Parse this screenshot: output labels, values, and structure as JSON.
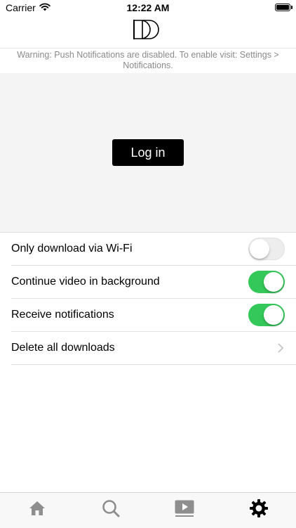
{
  "status_bar": {
    "carrier": "Carrier",
    "time": "12:22 AM",
    "wifi_icon": "wifi-icon",
    "battery_icon": "battery-icon"
  },
  "nav_bar": {
    "logo_icon": "dd-logo-icon"
  },
  "warning": {
    "text": "Warning: Push Notifications are disabled. To enable visit: Settings > Notifications."
  },
  "login": {
    "button_label": "Log in"
  },
  "settings": {
    "items": [
      {
        "label": "Only download via Wi-Fi",
        "control": "toggle",
        "on": false
      },
      {
        "label": "Continue video in background",
        "control": "toggle",
        "on": true
      },
      {
        "label": "Receive notifications",
        "control": "toggle",
        "on": true
      },
      {
        "label": "Delete all downloads",
        "control": "disclosure",
        "icon": "chevron-right-icon"
      }
    ]
  },
  "tab_bar": {
    "tabs": [
      {
        "icon": "home-icon",
        "selected": false
      },
      {
        "icon": "search-icon",
        "selected": false
      },
      {
        "icon": "video-icon",
        "selected": false
      },
      {
        "icon": "gear-icon",
        "selected": true
      }
    ]
  },
  "colors": {
    "toggle_on": "#34c759",
    "login_button": "#000000",
    "warning_text": "#8a8a8a",
    "tab_inactive": "#8e8e8e",
    "tab_active": "#000000"
  }
}
